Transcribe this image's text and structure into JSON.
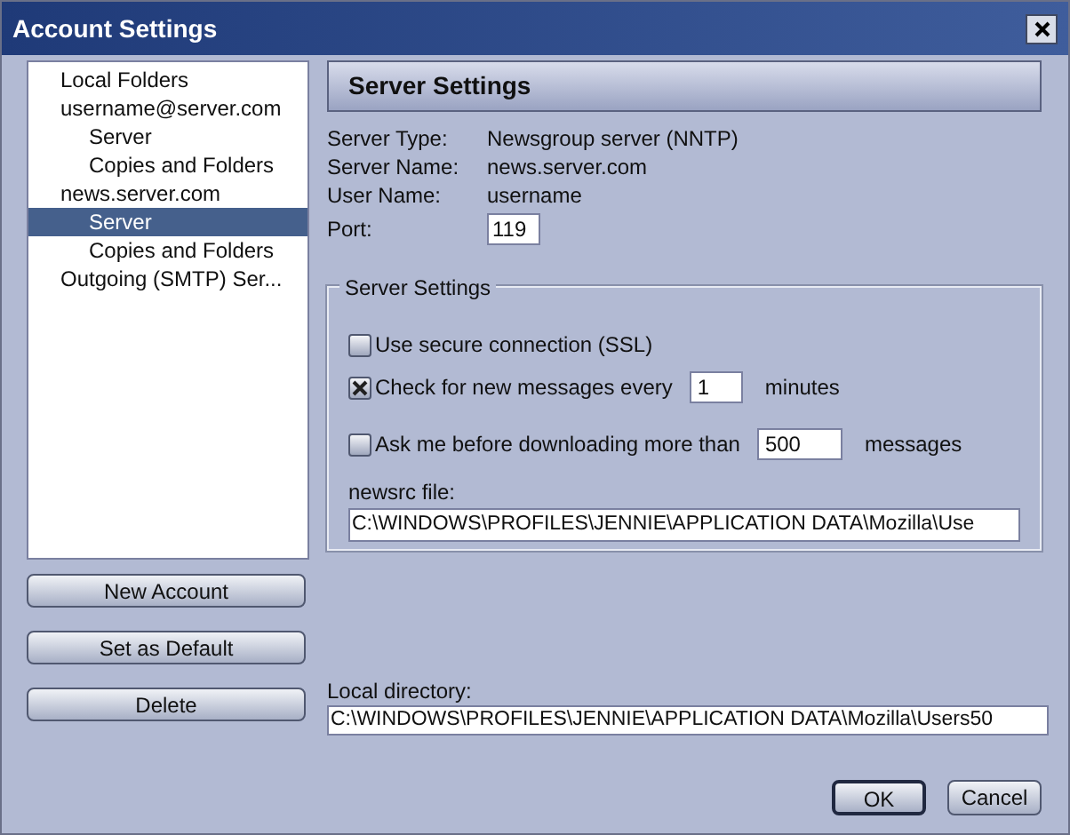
{
  "window": {
    "title": "Account Settings"
  },
  "tree": [
    {
      "label": "Local Folders",
      "selected": false
    },
    {
      "label": "username@server.com",
      "selected": false,
      "children": [
        {
          "label": "Server",
          "selected": false
        },
        {
          "label": "Copies and Folders",
          "selected": false
        }
      ]
    },
    {
      "label": "news.server.com",
      "selected": false,
      "children": [
        {
          "label": "Server",
          "selected": true
        },
        {
          "label": "Copies and Folders",
          "selected": false
        }
      ]
    },
    {
      "label": "Outgoing (SMTP) Ser...",
      "selected": false
    }
  ],
  "account_buttons": [
    "New Account",
    "Set as Default",
    "Delete"
  ],
  "panel": {
    "title": "Server Settings",
    "info": [
      {
        "label": "Server Type:",
        "value": "Newsgroup server (NNTP)"
      },
      {
        "label": "Server Name:",
        "value": "news.server.com"
      },
      {
        "label": "User Name:",
        "value": "username"
      }
    ],
    "port": {
      "label": "Port:",
      "value": "119"
    },
    "group": {
      "title": "Server Settings",
      "options": [
        {
          "label": "Use secure connection (SSL)",
          "checked": false
        },
        {
          "label": "Check for new messages every",
          "checked": true,
          "value": "1",
          "suffix": "minutes"
        },
        {
          "label": "Ask me before downloading more than",
          "checked": false,
          "value": "500",
          "suffix": "messages"
        }
      ],
      "newsrc": {
        "label": "newsrc file:",
        "value": "C:\\WINDOWS\\PROFILES\\JENNIE\\APPLICATION DATA\\Mozilla\\Use"
      }
    },
    "local_directory": {
      "label": "Local directory:",
      "value": "C:\\WINDOWS\\PROFILES\\JENNIE\\APPLICATION DATA\\Mozilla\\Users50"
    }
  },
  "dialog_buttons": [
    {
      "label": "OK",
      "default": true
    },
    {
      "label": "Cancel",
      "default": false
    }
  ]
}
